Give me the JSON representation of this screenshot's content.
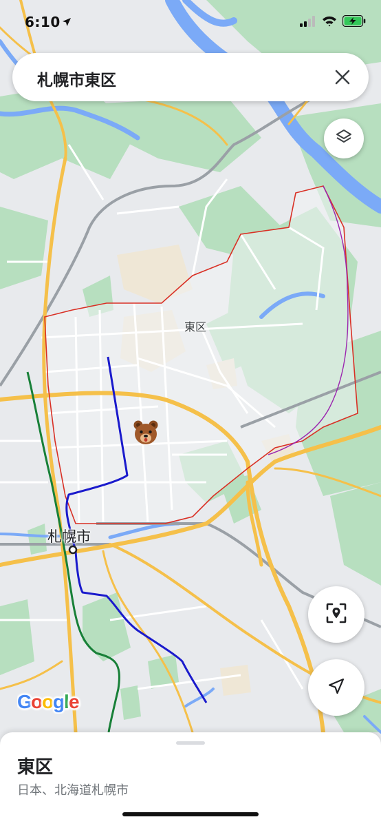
{
  "status_bar": {
    "time": "6:10"
  },
  "search": {
    "query": "札幌市東区"
  },
  "map": {
    "labels": {
      "district": "東区",
      "city": "札幌市"
    },
    "attribution": "Google",
    "colors": {
      "land": "#e8eaed",
      "park": "#b7dfbf",
      "water": "#7baaf7",
      "highway": "#f5c04a",
      "subway_blue": "#1a1acc",
      "subway_green": "#188038",
      "boundary": "#d93025"
    }
  },
  "place_sheet": {
    "title": "東区",
    "subtitle": "日本、北海道札幌市"
  },
  "icons": {
    "layers": "layers-icon",
    "close": "close-icon",
    "pin_scan": "pin-scan-icon",
    "navigate": "navigation-arrow-icon",
    "bear": "bear-icon"
  }
}
